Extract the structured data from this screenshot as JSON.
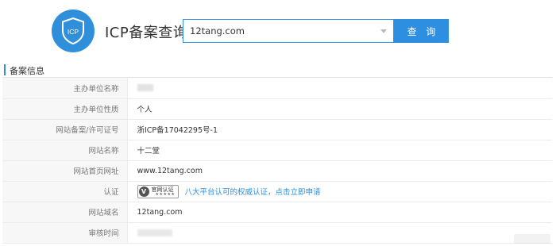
{
  "header": {
    "logo_text": "ICP",
    "title": "ICP备案查询"
  },
  "search": {
    "value": "12tang.com",
    "button_label": "查 询"
  },
  "section": {
    "title": "备案信息"
  },
  "rows": {
    "sponsor_name_label": "主办单位名称",
    "sponsor_type_label": "主办单位性质",
    "sponsor_type_value": "个人",
    "license_label": "网站备案/许可证号",
    "license_value": "浙ICP备17042295号-1",
    "site_name_label": "网站名称",
    "site_name_value": "十二堂",
    "homepage_label": "网站首页网址",
    "homepage_value": "www.12tang.com",
    "cert_label": "认证",
    "cert_badge_text": "官网认证",
    "cert_badge_stars": "★★★★★",
    "cert_link": "八大平台认可的权威认证，点击立即申请",
    "domain_label": "网站域名",
    "domain_value": "12tang.com",
    "review_time_label": "审核时间"
  },
  "colors": {
    "accent": "#2e8ee0",
    "logo_bg": "#2f8fdb"
  }
}
